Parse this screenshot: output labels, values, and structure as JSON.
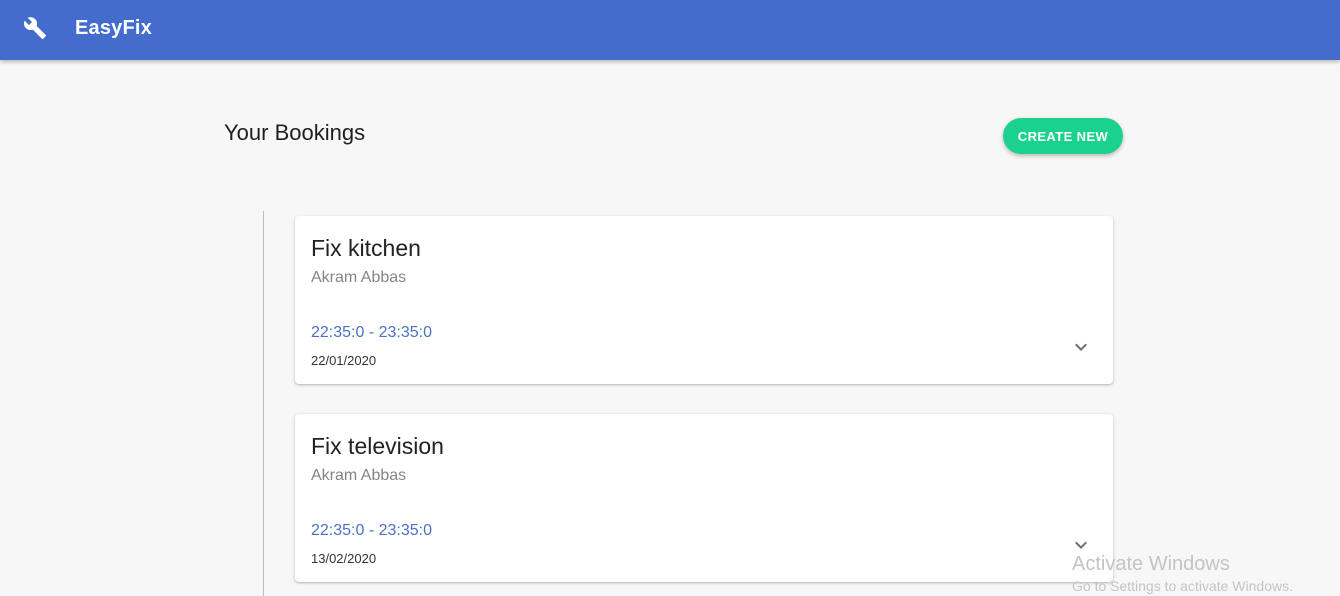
{
  "header": {
    "logo_icon": "wrench-icon",
    "brand": "EasyFix",
    "color": "#446ccc"
  },
  "main": {
    "title": "Your Bookings",
    "create_label": "CREATE NEW",
    "create_color": "#1bd18e"
  },
  "bookings": [
    {
      "title": "Fix kitchen",
      "person": "Akram Abbas",
      "time": "22:35:0 - 23:35:0",
      "date": "22/01/2020",
      "expand_icon": "chevron-down-icon"
    },
    {
      "title": "Fix television",
      "person": "Akram Abbas",
      "time": "22:35:0 - 23:35:0",
      "date": "13/02/2020",
      "expand_icon": "chevron-down-icon"
    }
  ],
  "watermark": {
    "title": "Activate Windows",
    "subtitle": "Go to Settings to activate Windows."
  }
}
